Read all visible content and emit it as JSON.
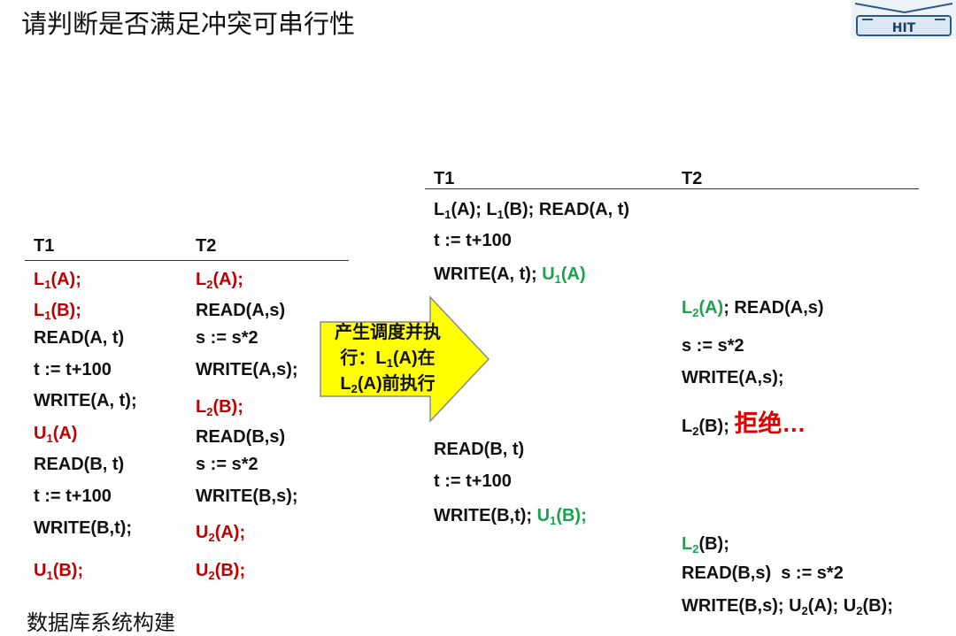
{
  "title": "请判断是否满足冲突可串行性",
  "logo": {
    "text": "HIT",
    "icon": "hit-university-logo-icon"
  },
  "left_table": {
    "header_t1": "T1",
    "header_t2": "T2",
    "t1": [
      {
        "main": "L",
        "sub": "1",
        "rest": "(A);",
        "color": "red"
      },
      {
        "main": "L",
        "sub": "1",
        "rest": "(B);",
        "color": "red"
      },
      {
        "text": "READ(A, t)",
        "color": "black"
      },
      {
        "text": "t := t+100",
        "color": "black"
      },
      {
        "text": "WRITE(A, t);",
        "color": "black"
      },
      {
        "main": "U",
        "sub": "1",
        "rest": "(A)",
        "color": "red"
      },
      {
        "text": "READ(B, t)",
        "color": "black"
      },
      {
        "text": "t := t+100",
        "color": "black"
      },
      {
        "text": "WRITE(B,t);",
        "color": "black"
      },
      {
        "main": "U",
        "sub": "1",
        "rest": "(B);",
        "color": "red"
      }
    ],
    "t2": [
      {
        "main": "L",
        "sub": "2",
        "rest": "(A);",
        "color": "red"
      },
      {
        "text": "READ(A,s)",
        "color": "black"
      },
      {
        "text": "s := s*2",
        "color": "black"
      },
      {
        "text": "WRITE(A,s);",
        "color": "black"
      },
      {
        "main": "L",
        "sub": "2",
        "rest": "(B);",
        "color": "red"
      },
      {
        "text": "READ(B,s)",
        "color": "black"
      },
      {
        "text": "s := s*2",
        "color": "black"
      },
      {
        "text": "WRITE(B,s);",
        "color": "black"
      },
      {
        "main": "U",
        "sub": "2",
        "rest": "(A);",
        "color": "red"
      },
      {
        "main": "U",
        "sub": "2",
        "rest": "(B);",
        "color": "red"
      }
    ]
  },
  "arrow": {
    "line1": "产生调度并执",
    "line2_pre": "行：L",
    "line2_sub": "1",
    "line2_post": "(A)在",
    "line3_main": "L",
    "line3_sub": "2",
    "line3_post": "(A)前执行",
    "fill": "#ffff00"
  },
  "right_table": {
    "header_t1": "T1",
    "header_t2": "T2",
    "r1": {
      "a": "L",
      "a_sub": "1",
      "b": "(A); L",
      "b_sub": "1",
      "c": "(B); READ(A, t)"
    },
    "r2": "t := t+100",
    "r3": {
      "pre": "WRITE(A, t); ",
      "u": "U",
      "u_sub": "1",
      "u_post": "(A)"
    },
    "t2_r1": {
      "l": "L",
      "l_sub": "2",
      "l_post": "(A)",
      "rest": "; READ(A,s)"
    },
    "t2_r2": "s := s*2",
    "t2_r3": "WRITE(A,s);",
    "t2_r4": {
      "l": "L",
      "l_sub": "2",
      "l_post": "(B); ",
      "reject": "拒绝…"
    },
    "r4": "READ(B, t)",
    "r5": "t := t+100",
    "r6": {
      "pre": "WRITE(B,t); ",
      "u": "U",
      "u_sub": "1",
      "u_post": "(B);"
    },
    "t2_r5": {
      "l": "L",
      "l_sub": "2",
      "l_post": "(B);"
    },
    "t2_r6": "READ(B,s)  s := s*2",
    "t2_r7": {
      "pre": "WRITE(B,s); U",
      "s1": "2",
      "mid": "(A); U",
      "s2": "2",
      "post": "(B);"
    }
  },
  "colors": {
    "red": "#c00000",
    "green": "#1aa34a",
    "reject": "#e00000"
  },
  "footer": "数据库系统构建"
}
